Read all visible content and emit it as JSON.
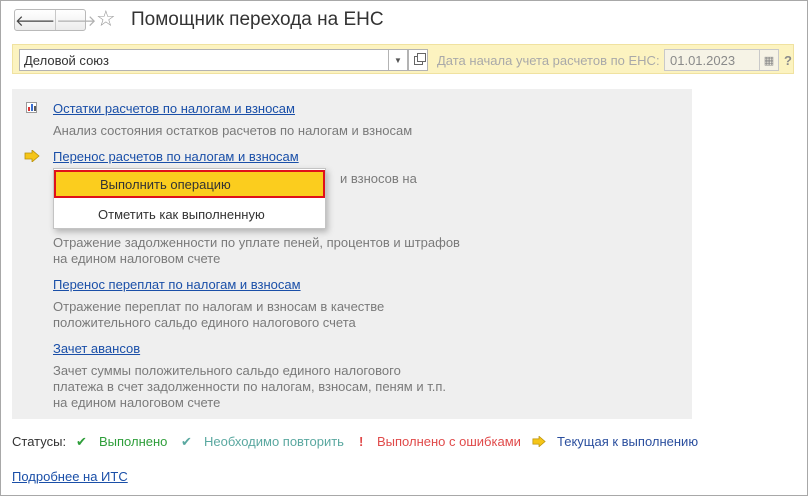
{
  "header": {
    "back_glyph": "🡐",
    "forward_glyph": "🡒",
    "favorite_glyph": "☆",
    "title": "Помощник перехода на ЕНС"
  },
  "toolbar": {
    "organization_value": "Деловой союз",
    "dropdown_glyph": "▼",
    "date_label": "Дата начала учета расчетов по ЕНС:",
    "date_value": "01.01.2023",
    "calendar_glyph": "▦",
    "help_glyph": "?"
  },
  "steps": [
    {
      "link": "Остатки расчетов по налогам и взносам",
      "description": "Анализ состояния остатков расчетов по налогам и взносам",
      "icon": "chart-icon"
    },
    {
      "link": "Перенос расчетов по налогам и взносам",
      "description_tail": "и взносов на",
      "icon": "current-step-arrow-icon"
    },
    {
      "description": "Отражение задолженности по уплате пеней, процентов и штрафов\nна едином налоговом счете"
    },
    {
      "link": "Перенос переплат по налогам и взносам",
      "description": "Отражение переплат по налогам и взносам в качестве\nположительного сальдо единого налогового счета"
    },
    {
      "link": "Зачет авансов",
      "description": "Зачет суммы положительного сальдо единого налогового\nплатежа в счет задолженности по налогам, взносам, пеням и т.п.\nна едином налоговом счете"
    }
  ],
  "popup_menu": {
    "items": [
      {
        "label": "Выполнить операцию"
      },
      {
        "label": "Отметить как выполненную"
      }
    ]
  },
  "statuses": {
    "label": "Статусы:",
    "done": {
      "glyph": "✔",
      "label": "Выполнено",
      "color": "#2e9e3a"
    },
    "repeat": {
      "glyph": "✔",
      "label": "Необходимо повторить",
      "color": "#5aa8a0"
    },
    "errors": {
      "glyph": "!",
      "label": "Выполнено с ошибками",
      "color": "#e04a4a"
    },
    "current": {
      "label": "Текущая к выполнению",
      "color": "#2b4f9e"
    }
  },
  "footer": {
    "its_link": "Подробнее на ИТС"
  },
  "colors": {
    "toolbar_bg": "#fcf3c0",
    "panel_bg": "#efefef",
    "link": "#1a4fa8",
    "menu_highlight": "#fbcd1e",
    "menu_highlight_border": "#e0101a",
    "arrow_fill": "#f5c518"
  }
}
